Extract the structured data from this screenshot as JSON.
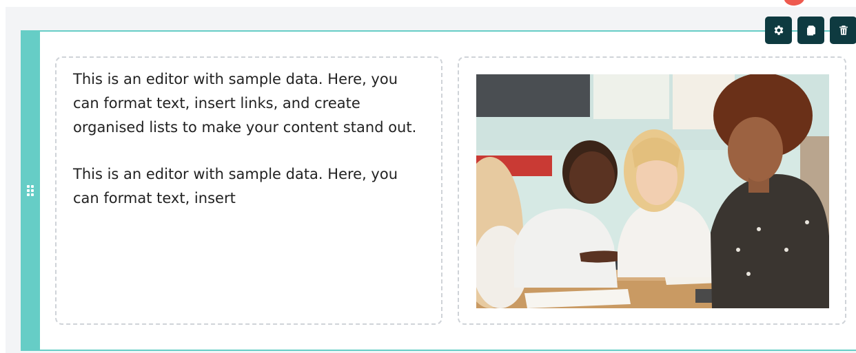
{
  "editor": {
    "toolbar": {
      "settings": {
        "icon": "gear-icon"
      },
      "duplicate": {
        "icon": "copy-icon"
      },
      "delete": {
        "icon": "trash-icon"
      }
    },
    "drag_handle": {
      "icon": "grip-icon"
    },
    "text_block": {
      "paragraphs": [
        "This is an editor with sample data. Here, you can format text, insert links, and create organised lists to make your content stand out.",
        "This is an editor with sample data. Here, you can format text, insert"
      ]
    },
    "image_block": {
      "image": "photo-teacher-and-students"
    }
  },
  "colors": {
    "accent": "#66cdc6",
    "toolbar_bg": "#0e3a40",
    "canvas_bg": "#f3f4f6",
    "dashed_border": "#cfd3d8",
    "marker": "#ee5a4f"
  }
}
